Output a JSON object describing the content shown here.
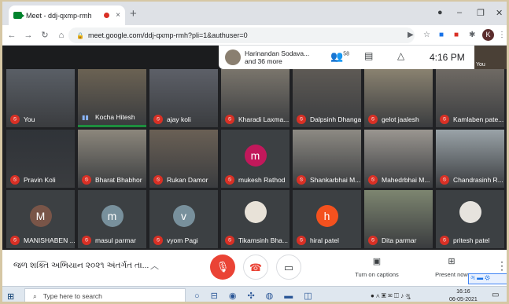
{
  "browser": {
    "tab_title": "Meet - ddj-qxmp-rmh",
    "new_tab": "+",
    "close_tab": "×",
    "minimize": "–",
    "maximize": "❐",
    "close": "✕",
    "url": "meet.google.com/ddj-qxmp-rmh?pli=1&authuser=0",
    "profile_initial": "K"
  },
  "meet_header": {
    "presenter_line1": "Harinandan Sodava...",
    "presenter_line2": "and 36 more",
    "people_count": "58",
    "time": "4:16 PM",
    "self_label": "You"
  },
  "participants": [
    {
      "name": "You",
      "type": "video",
      "color": "#5a5f66"
    },
    {
      "name": "Kocha Hitesh",
      "type": "video",
      "color": "#6b6253",
      "speaking": true
    },
    {
      "name": "ajay koli",
      "type": "video",
      "color": "#5d6068"
    },
    {
      "name": "Kharadi Laxma...",
      "type": "video",
      "color": "#7a756c"
    },
    {
      "name": "Dalpsinh Dhanga",
      "type": "video",
      "color": "#5e5a55"
    },
    {
      "name": "gelot jaalesh",
      "type": "video",
      "color": "#8a8270"
    },
    {
      "name": "Kamlaben pate...",
      "type": "video",
      "color": "#6f6a64"
    },
    {
      "name": "Pravin Koli",
      "type": "video",
      "color": "#2f3338"
    },
    {
      "name": "Bharat Bhabhor",
      "type": "video",
      "color": "#8c877c"
    },
    {
      "name": "Rukan Damor",
      "type": "video",
      "color": "#6a6055"
    },
    {
      "name": "mukesh Rathod",
      "type": "avatar",
      "initial": "m",
      "color": "#c2185b"
    },
    {
      "name": "Shankarbhai M...",
      "type": "video",
      "color": "#8d8a83"
    },
    {
      "name": "Mahedrbhai M...",
      "type": "video",
      "color": "#9a9690"
    },
    {
      "name": "Chandrasinh R...",
      "type": "video",
      "color": "#9aa3a8"
    },
    {
      "name": "MANISHABEN ...",
      "type": "avatar",
      "initial": "M",
      "color": "#795548"
    },
    {
      "name": "masul parmar",
      "type": "avatar",
      "initial": "m",
      "color": "#78909c"
    },
    {
      "name": "vyom Pagi",
      "type": "avatar",
      "initial": "v",
      "color": "#78909c"
    },
    {
      "name": "Tikamsinh Bha...",
      "type": "photo",
      "color": "#e8e2d8"
    },
    {
      "name": "hiral patel",
      "type": "avatar",
      "initial": "h",
      "color": "#f4511e"
    },
    {
      "name": "Dita parmar",
      "type": "video",
      "color": "#7d8670"
    },
    {
      "name": "pritesh patel",
      "type": "photo",
      "color": "#e6e3de"
    }
  ],
  "bottom_bar": {
    "meeting_title": "જળ શક્તિ અભિયાન ૨૦૨૧ અંતર્ગત તા...",
    "captions_label": "Turn on captions",
    "present_label": "Present now",
    "lang_badge": "ગ"
  },
  "taskbar": {
    "search_placeholder": "Type here to search",
    "clock_time": "16:16",
    "clock_date": "06-05-2021",
    "lang": "ગુ"
  }
}
